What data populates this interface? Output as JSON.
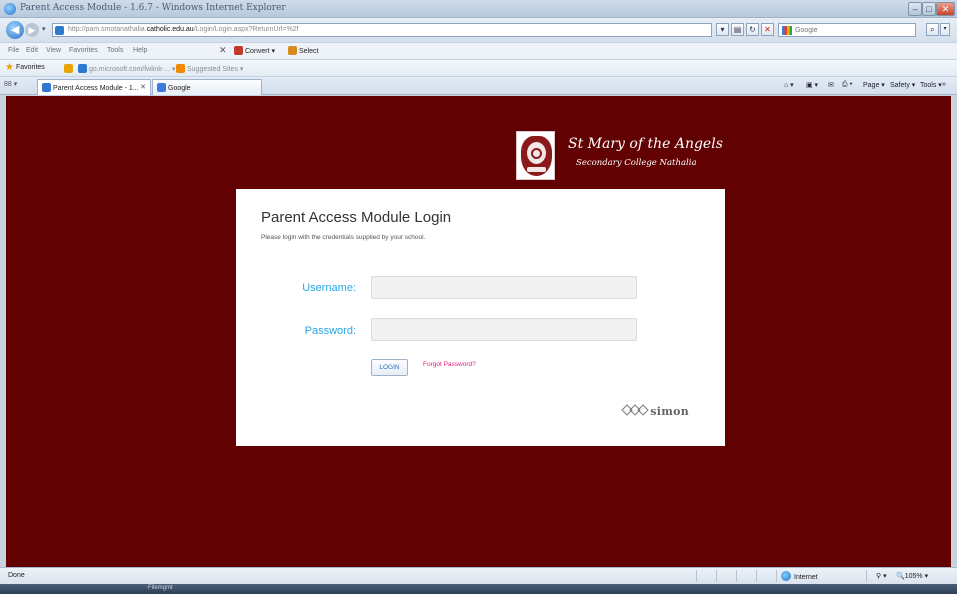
{
  "window": {
    "title": "Parent Access Module - 1.6.7 - Windows Internet Explorer",
    "min": "–",
    "max": "□",
    "close": "✕"
  },
  "addressbar": {
    "back": "◀",
    "forward": "▶",
    "url_prefix": "http://pam.smotanathalia.",
    "url_domain": "catholic.edu.au",
    "url_suffix": "/Login/Login.aspx?ReturnUrl=%2f",
    "search_placeholder": "Google",
    "search_go": "⌕"
  },
  "menubar": {
    "items": [
      "File",
      "Edit",
      "View",
      "Favorites",
      "Tools",
      "Help"
    ],
    "close": "✕",
    "convert": "Convert",
    "select": "Select"
  },
  "favbar": {
    "label": "Favorites",
    "link1": "go.microsoft.com/fwlink-...",
    "link2": "Suggested Sites"
  },
  "tabs": {
    "quick": "88",
    "active": "Parent Access Module - 1...",
    "close": "✕",
    "second": "Google"
  },
  "commandbar": {
    "page": "Page",
    "safety": "Safety",
    "tools": "Tools"
  },
  "page": {
    "school_name": "St Mary of the Angels",
    "school_sub": "Secondary College Nathalia",
    "login_title": "Parent Access Module Login",
    "login_sub": "Please login with the credentials supplied by your school.",
    "username_label": "Username:",
    "password_label": "Password:",
    "login_button": "LOGIN",
    "forgot_link": "Forgot Password?",
    "simon_text": "simon"
  },
  "statusbar": {
    "status": "Done",
    "zone": "Internet",
    "zoom": "105%"
  },
  "taskbar": {
    "text": "Filemgmt"
  },
  "colors": {
    "page_background": "#620102",
    "label_blue": "#28a7e6",
    "link_pink": "#e01e7e"
  }
}
